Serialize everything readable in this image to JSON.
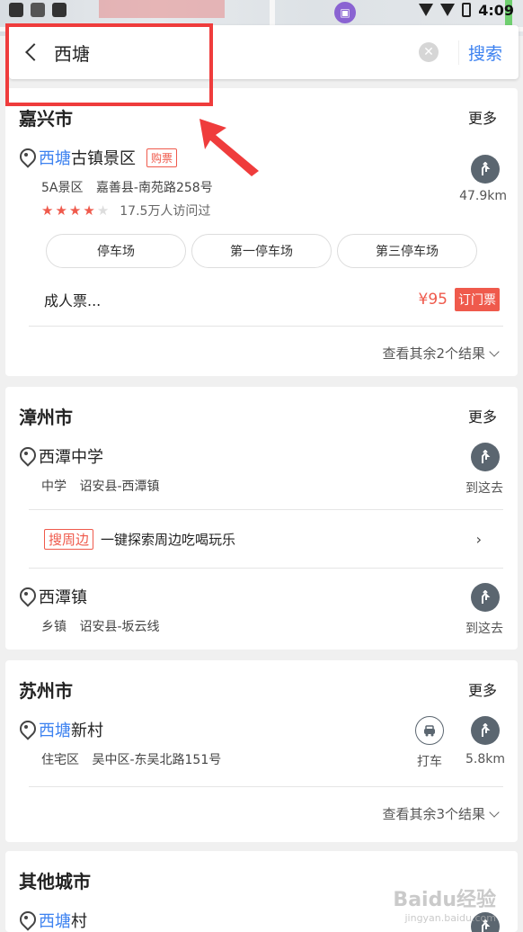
{
  "status_bar": {
    "time": "4:09"
  },
  "search": {
    "value": "西塘",
    "button_label": "搜索"
  },
  "sections": [
    {
      "city": "嘉兴市",
      "more": "更多",
      "poi": {
        "name_highlight": "西塘",
        "name_rest": "古镇景区",
        "tag": "购票",
        "category": "5A景区",
        "address": "嘉善县-南苑路258号",
        "rating_stars": 4,
        "visits": "17.5万人访问过",
        "distance": "47.9km"
      },
      "chips": [
        "停车场",
        "第一停车场",
        "第三停车场"
      ],
      "ticket": {
        "name": "成人票...",
        "price": "¥95",
        "button": "订门票"
      },
      "see_more": "查看其余2个结果"
    },
    {
      "city": "漳州市",
      "more": "更多",
      "pois": [
        {
          "name": "西潭中学",
          "category": "中学",
          "address": "诏安县-西潭镇",
          "action": "到这去"
        },
        {
          "name": "西潭镇",
          "category": "乡镇",
          "address": "诏安县-坂云线",
          "action": "到这去"
        }
      ],
      "nearby": {
        "tag": "搜周边",
        "text": "一键探索周边吃喝玩乐",
        "chevron": "›"
      }
    },
    {
      "city": "苏州市",
      "more": "更多",
      "poi": {
        "name_highlight": "西塘",
        "name_rest": "新村",
        "category": "住宅区",
        "address": "吴中区-东吴北路151号",
        "taxi": "打车",
        "distance": "5.8km"
      },
      "see_more": "查看其余3个结果"
    },
    {
      "city": "其他城市",
      "poi": {
        "name_highlight": "西塘",
        "name_rest": "村"
      }
    }
  ],
  "watermark": {
    "main": "Baidu经验",
    "sub": "jingyan.baidu.com"
  }
}
